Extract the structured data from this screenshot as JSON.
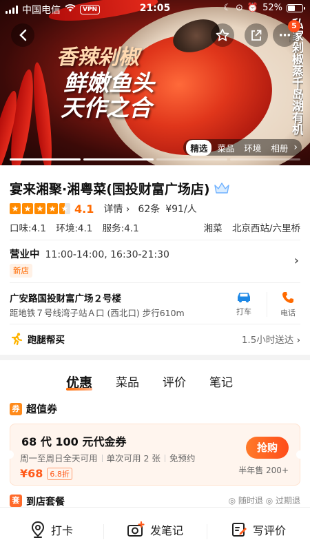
{
  "status_bar": {
    "carrier": "中国电信",
    "vpn": "VPN",
    "time": "21:05",
    "battery": "52%",
    "battery_level": 0.52
  },
  "hero": {
    "text_line1": "香辣剁椒",
    "text_line2": "鲜嫩鱼头",
    "text_line3": "天作之合",
    "side_text": "私家剁椒蒸千岛湖有机鱼头",
    "notification_count": "5",
    "photo_tabs": [
      "精选",
      "菜品",
      "环境",
      "相册"
    ],
    "active_photo_tab": 0,
    "slides": 4,
    "active_slide": 1
  },
  "shop": {
    "name": "宴来湘聚·湘粤菜(国投财富广场店)",
    "rating": "4.1",
    "stars_full": 4,
    "detail_label": "详情",
    "reviews": "62条",
    "avg_price": "¥91/人",
    "taste": "口味:4.1",
    "environment": "环境:4.1",
    "service": "服务:4.1",
    "cuisine": "湘菜",
    "area": "北京西站/六里桥",
    "hours_label": "营业中",
    "hours": "11:00-14:00, 16:30-21:30",
    "new_tag": "新店",
    "address": "广安路国投财富广场２号楼",
    "subway": "距地铁７号线湾子站Ａ口 (西北口) 步行610m",
    "taxi_label": "打车",
    "call_label": "电话",
    "runner_label": "跑腿帮买",
    "runner_eta": "1.5小时送达"
  },
  "tabs": [
    "优惠",
    "菜品",
    "评价",
    "笔记"
  ],
  "active_tab": 0,
  "deals": {
    "section_icon": "券",
    "section_title": "超值券",
    "coupon_title": "68 代 100 元代金券",
    "coupon_terms": [
      "周一至周日全天可用",
      "单次可用 2 张",
      "免预约"
    ],
    "price": "¥68",
    "discount": "6.8折",
    "buy_label": "抢购",
    "sold": "半年售 200+"
  },
  "peek": {
    "icon": "套",
    "title": "到店套餐",
    "right": "◎ 随时退   ◎ 过期退"
  },
  "bottom_bar": {
    "checkin": "打卡",
    "post_note": "发笔记",
    "write_review": "写评价"
  },
  "colors": {
    "accent": "#ff6a00",
    "buy_button": "#ff4d1a",
    "star": "#ff8a00"
  }
}
